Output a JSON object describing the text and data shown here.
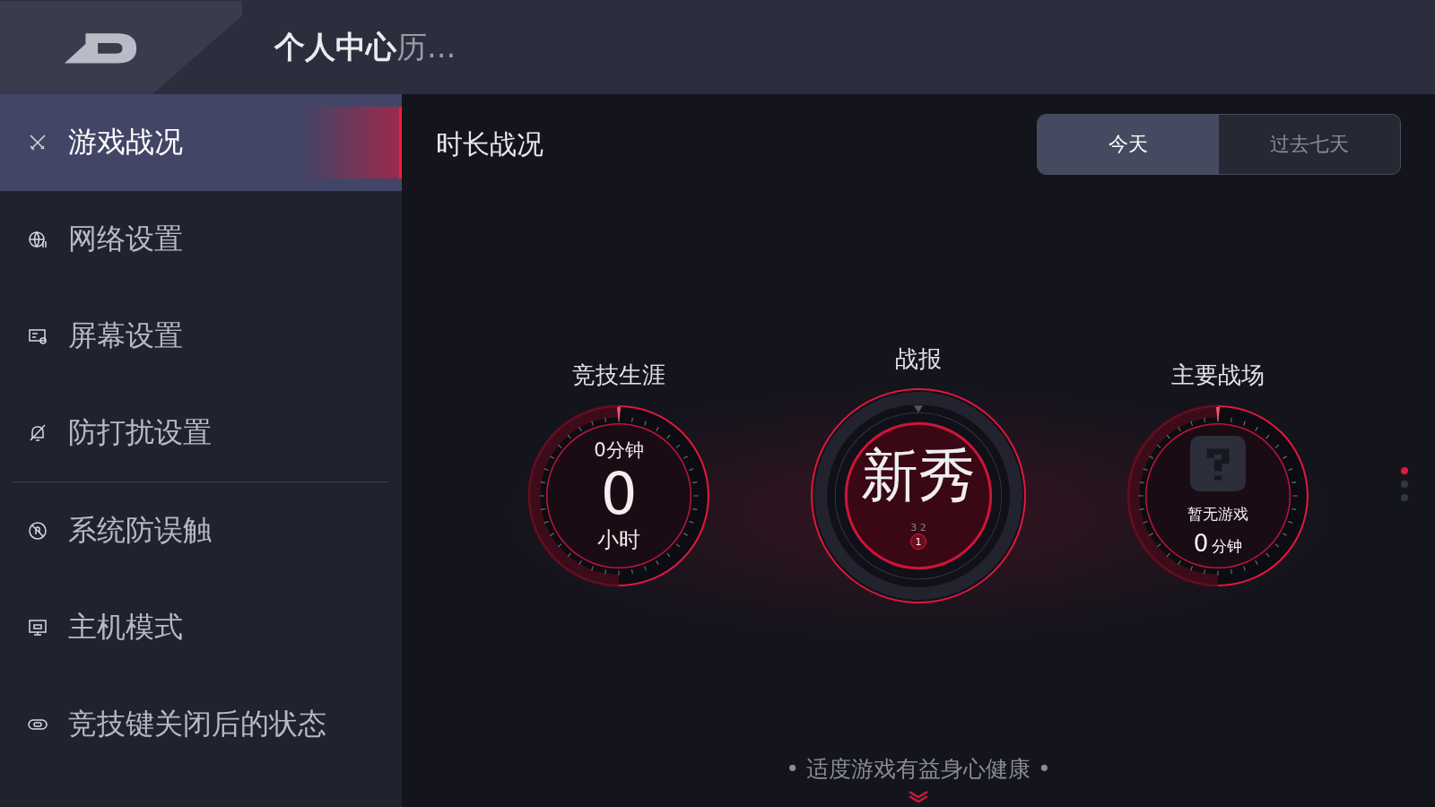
{
  "header": {
    "title": "个人中心",
    "title_tail": "历..."
  },
  "sidebar": {
    "items": [
      {
        "label": "游戏战况",
        "selected": true
      },
      {
        "label": "网络设置",
        "selected": false
      },
      {
        "label": "屏幕设置",
        "selected": false
      },
      {
        "label": "防打扰设置",
        "selected": false
      },
      {
        "label": "系统防误触",
        "selected": false
      },
      {
        "label": "主机模式",
        "selected": false
      },
      {
        "label": "竞技键关闭后的状态",
        "selected": false
      }
    ]
  },
  "content": {
    "title": "时长战况",
    "tabs": [
      {
        "label": "今天",
        "selected": true
      },
      {
        "label": "过去七天",
        "selected": false
      }
    ],
    "gauges": [
      {
        "kind": "career",
        "title": "竞技生涯",
        "top": "0分钟",
        "value": "0",
        "unit": "小时"
      },
      {
        "kind": "report",
        "title": "战报",
        "rank": "新秀",
        "small": "3 2",
        "badge": "1"
      },
      {
        "kind": "field",
        "title": "主要战场",
        "label": "暂无游戏",
        "value": "0",
        "unit": "分钟"
      }
    ],
    "pages": [
      {
        "selected": true
      },
      {
        "selected": false
      },
      {
        "selected": false
      }
    ],
    "footer": "• 适度游戏有益身心健康 •"
  }
}
